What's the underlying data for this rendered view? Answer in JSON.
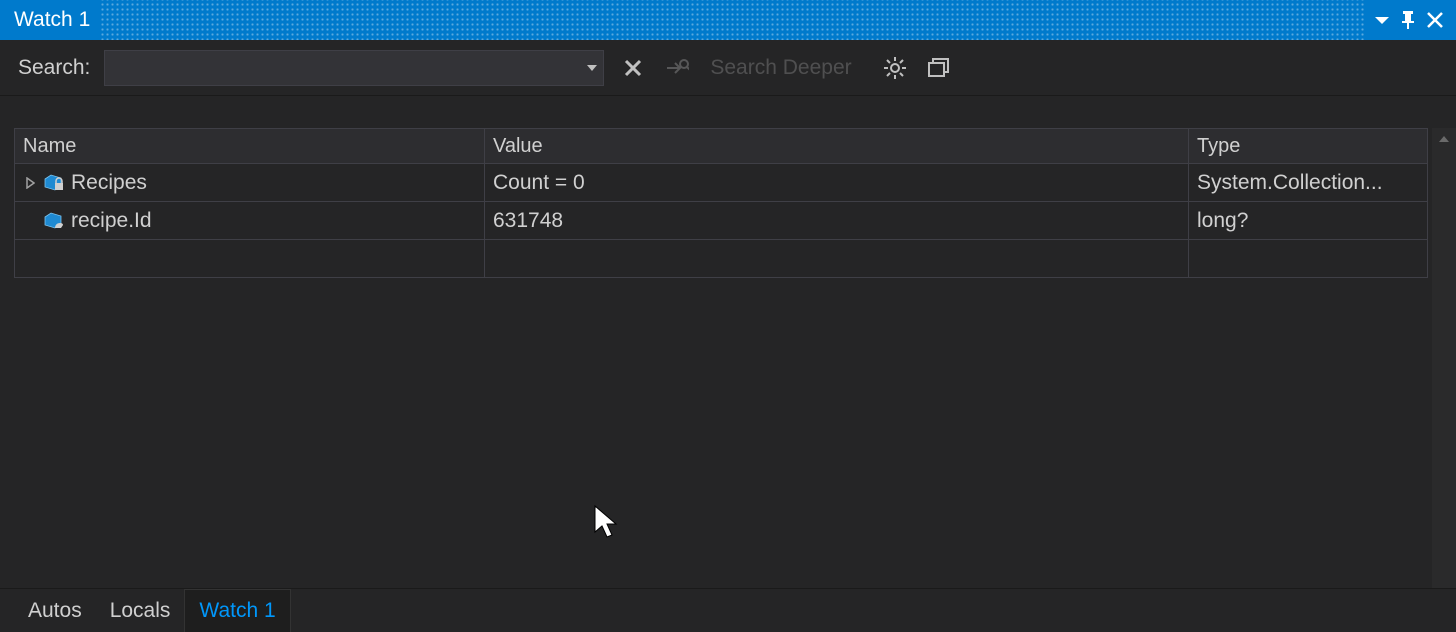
{
  "window": {
    "title": "Watch 1"
  },
  "toolbar": {
    "search_label": "Search:",
    "search_value": "",
    "search_deeper_label": "Search Deeper"
  },
  "grid": {
    "columns": {
      "name": "Name",
      "value": "Value",
      "type": "Type"
    },
    "rows": [
      {
        "expandable": true,
        "icon": "locked",
        "name": "Recipes",
        "value": "Count = 0",
        "type": "System.Collection..."
      },
      {
        "expandable": false,
        "icon": "prop",
        "name": "recipe.Id",
        "value": "631748",
        "type": "long?"
      }
    ]
  },
  "tabs": [
    {
      "label": "Autos",
      "active": false
    },
    {
      "label": "Locals",
      "active": false
    },
    {
      "label": "Watch 1",
      "active": true
    }
  ]
}
